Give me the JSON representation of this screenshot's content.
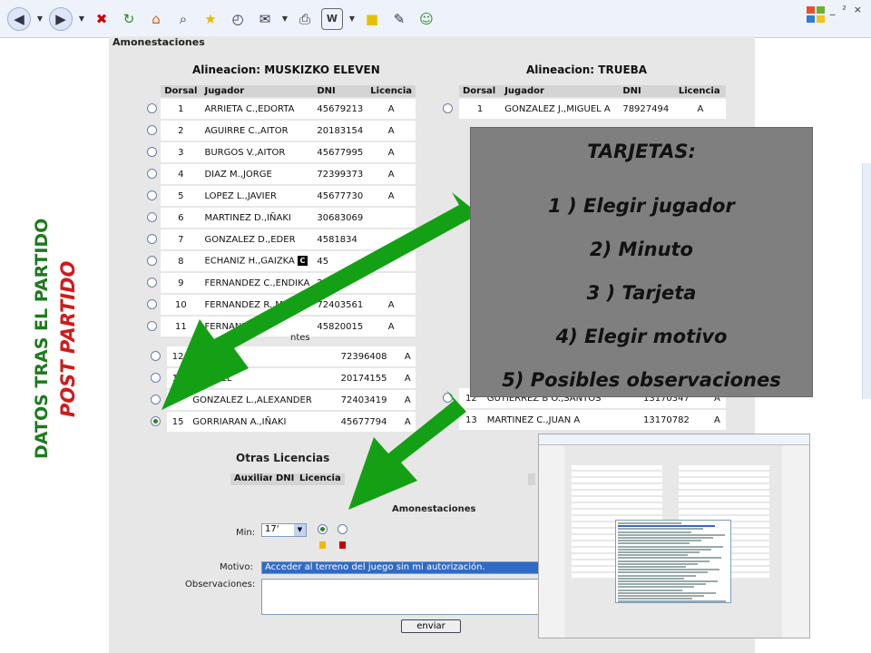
{
  "window": {
    "min": "_",
    "restore": "²",
    "close": "×"
  },
  "page": {
    "header": "Amonestaciones",
    "home": {
      "title": "Alineacion: MUSKIZKO ELEVEN",
      "columns": [
        "Dorsal",
        "Jugador",
        "DNI",
        "Licencia"
      ],
      "players": [
        {
          "dorsal": "1",
          "jugador": "ARRIETA C.,EDORTA",
          "dni": "45679213",
          "licencia": "A"
        },
        {
          "dorsal": "2",
          "jugador": "AGUIRRE C.,AITOR",
          "dni": "20183154",
          "licencia": "A"
        },
        {
          "dorsal": "3",
          "jugador": "BURGOS V.,AITOR",
          "dni": "45677995",
          "licencia": "A"
        },
        {
          "dorsal": "4",
          "jugador": "DIAZ M.,JORGE",
          "dni": "72399373",
          "licencia": "A"
        },
        {
          "dorsal": "5",
          "jugador": "LOPEZ L.,JAVIER",
          "dni": "45677730",
          "licencia": "A"
        },
        {
          "dorsal": "6",
          "jugador": "MARTINEZ D.,IÑAKI",
          "dni": "30683069",
          "licencia": ""
        },
        {
          "dorsal": "7",
          "jugador": "GONZALEZ D.,EDER",
          "dni": "4581834",
          "licencia": ""
        },
        {
          "dorsal": "8",
          "jugador": "ECHANIZ H.,GAIZKA",
          "dni": "45",
          "licencia": ""
        },
        {
          "dorsal": "9",
          "jugador": "FERNANDEZ C.,ENDIKA",
          "dni": "27",
          "licencia": ""
        },
        {
          "dorsal": "10",
          "jugador": "FERNANDEZ R.,MI",
          "dni": "72403561",
          "licencia": "A"
        },
        {
          "dorsal": "11",
          "jugador": "FERNANDEZ",
          "dni": "45820015",
          "licencia": "A"
        }
      ],
      "captain_mark": "C",
      "substitutes_label": "ntes",
      "substitutes": [
        {
          "dorsal": "12",
          "jugador": "S.,DAVID",
          "dni": "72396408",
          "licencia": "A"
        },
        {
          "dorsal": "13",
          "jugador": "GABRIEL",
          "dni": "20174155",
          "licencia": "A"
        },
        {
          "dorsal": "",
          "jugador": "GONZALEZ L.,ALEXANDER",
          "dni": "72403419",
          "licencia": "A"
        },
        {
          "dorsal": "15",
          "jugador": "GORRIARAN A.,IÑAKI",
          "dni": "45677794",
          "licencia": "A"
        }
      ]
    },
    "away": {
      "title": "Alineacion: TRUEBA",
      "columns": [
        "Dorsal",
        "Jugador",
        "DNI",
        "Licencia"
      ],
      "players": [
        {
          "dorsal": "1",
          "jugador": "GONZALEZ J.,MIGUEL A",
          "dni": "78927494",
          "licencia": "A"
        }
      ],
      "substitutes": [
        {
          "dorsal": "12",
          "jugador": "GUTIERREZ B O.,SANTOS",
          "dni": "13170347",
          "licencia": "A"
        },
        {
          "dorsal": "13",
          "jugador": "MARTINEZ C.,JUAN A",
          "dni": "13170782",
          "licencia": "A"
        }
      ]
    },
    "otras_licencias": "Otras Licencias",
    "otras_columns": [
      "Auxiliar",
      "DNI",
      "Licencia"
    ],
    "form": {
      "section": "Amonestaciones",
      "min_label": "Min:",
      "min_value": "17'",
      "motivo_label": "Motivo:",
      "motivo_value": "Acceder al terreno del juego sin mi autorización.",
      "observaciones_label": "Observaciones:",
      "submit": "enviar"
    }
  },
  "side_titles": {
    "line1": "DATOS TRAS EL PARTIDO",
    "line2": "POST PARTIDO",
    "line1_color": "#1d7a1d",
    "line2_color": "#d11a1a"
  },
  "instructions": {
    "title": "TARJETAS:",
    "steps": [
      "1 ) Elegir jugador",
      "2) Minuto",
      "3 ) Tarjeta",
      "4) Elegir motivo",
      "5) Posibles observaciones"
    ]
  },
  "colors": {
    "arrow": "#14a014",
    "yellow_card": "#f2b900",
    "red_card": "#c40000"
  }
}
